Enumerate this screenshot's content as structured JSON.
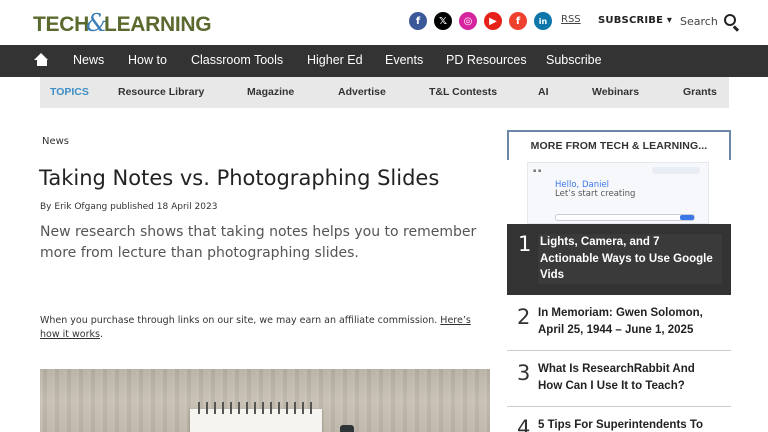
{
  "header": {
    "logo_left": "TECH",
    "logo_amp": "&",
    "logo_right": "LEARNING",
    "social": [
      {
        "name": "facebook-icon",
        "glyph": "f"
      },
      {
        "name": "x-icon",
        "glyph": "𝕏"
      },
      {
        "name": "instagram-icon",
        "glyph": "◎"
      },
      {
        "name": "youtube-icon",
        "glyph": "▶"
      },
      {
        "name": "flipboard-icon",
        "glyph": "f"
      },
      {
        "name": "linkedin-icon",
        "glyph": "in"
      }
    ],
    "rss_label": "RSS",
    "subscribe_label": "SUBSCRIBE ▾",
    "search_label": "Search"
  },
  "nav": {
    "items": [
      "News",
      "How to",
      "Classroom Tools",
      "Higher Ed",
      "Events",
      "PD Resources",
      "Subscribe"
    ]
  },
  "topics": {
    "items": [
      "TOPICS",
      "Resource Library",
      "Magazine",
      "Advertise",
      "T&L Contests",
      "AI",
      "Webinars",
      "Grants"
    ]
  },
  "article": {
    "breadcrumb": "News",
    "title": "Taking Notes vs. Photographing Slides",
    "byline_prefix": "By",
    "author": "Erik Ofgang",
    "published_prefix": "published",
    "date": "18 April 2023",
    "standfirst": "New research shows that taking notes helps you to remember more from lecture than photographing slides.",
    "affiliate_text": "When you purchase through links on our site, we may earn an affiliate commission.",
    "affiliate_link": "Here’s how it works",
    "affiliate_end": "."
  },
  "sidebar": {
    "title": "MORE FROM TECH & LEARNING...",
    "thumb": {
      "hello": "Hello, Daniel",
      "start": "Let’s start creating"
    },
    "items": [
      {
        "num": "1",
        "headline": "Lights, Camera, and 7 Actionable Ways to Use Google Vids"
      },
      {
        "num": "2",
        "headline": "In Memoriam: Gwen Solomon, April 25, 1944 – June 1, 2025"
      },
      {
        "num": "3",
        "headline": "What Is ResearchRabbit And How Can I Use It to Teach?"
      },
      {
        "num": "4",
        "headline": "5 Tips For Superintendents To"
      }
    ]
  },
  "colors": {
    "nav_bg": "#333333",
    "topics_bg": "#e8e8e8",
    "topics_accent": "#3d8ec5",
    "logo_green": "#5a6a2e",
    "sidebar_border": "#6a87a8"
  }
}
